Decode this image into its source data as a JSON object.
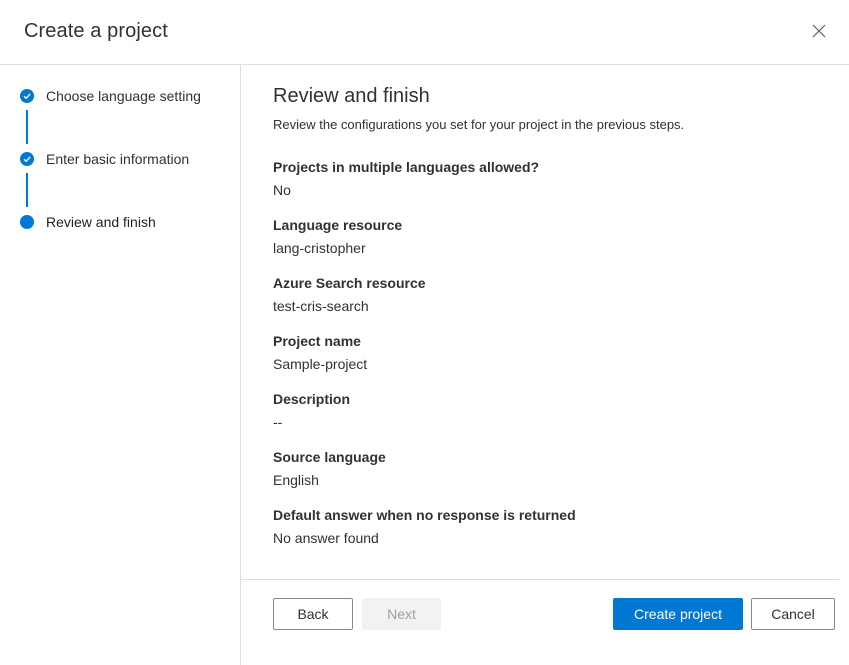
{
  "dialog": {
    "title": "Create a project",
    "close_icon": "close-icon"
  },
  "steps": [
    {
      "label": "Choose language setting",
      "state": "completed",
      "icon": "checkmark-icon"
    },
    {
      "label": "Enter basic information",
      "state": "completed",
      "icon": "checkmark-icon"
    },
    {
      "label": "Review and finish",
      "state": "current",
      "icon": "dot-icon"
    }
  ],
  "review": {
    "title": "Review and finish",
    "subtitle": "Review the configurations you set for your project in the previous steps.",
    "fields": [
      {
        "label": "Projects in multiple languages allowed?",
        "value": "No"
      },
      {
        "label": "Language resource",
        "value": "lang-cristopher"
      },
      {
        "label": "Azure Search resource",
        "value": "test-cris-search"
      },
      {
        "label": "Project name",
        "value": "Sample-project"
      },
      {
        "label": "Description",
        "value": "--"
      },
      {
        "label": "Source language",
        "value": "English"
      },
      {
        "label": "Default answer when no response is returned",
        "value": "No answer found"
      }
    ]
  },
  "footer": {
    "back_label": "Back",
    "next_label": "Next",
    "create_label": "Create project",
    "cancel_label": "Cancel"
  },
  "colors": {
    "accent": "#0078d4",
    "border": "#e1dfdd",
    "text": "#323130",
    "disabled_bg": "#f3f2f1",
    "disabled_text": "#a19f9d"
  }
}
